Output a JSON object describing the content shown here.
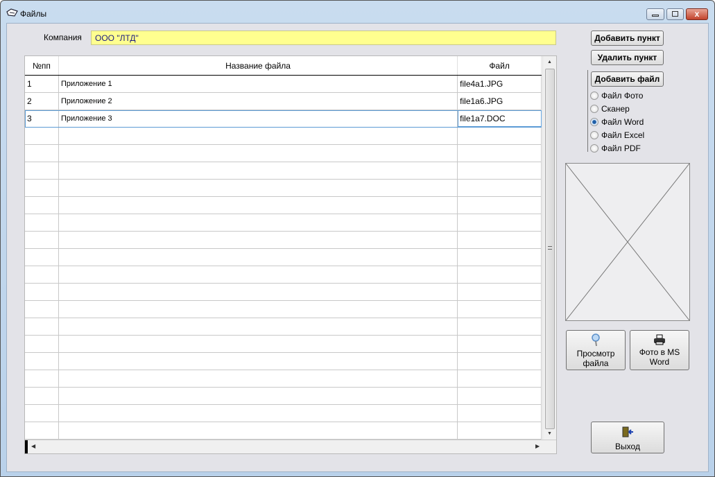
{
  "window": {
    "title": "Файлы",
    "close_glyph": "x"
  },
  "form": {
    "company_label": "Компания",
    "company_value": "ООО \"ЛТД\""
  },
  "table": {
    "headers": [
      "№пп",
      "Название файла",
      "Файл"
    ],
    "rows": [
      {
        "num": "1",
        "name": "Приложение 1",
        "file": "file4a1.JPG"
      },
      {
        "num": "2",
        "name": "Приложение 2",
        "file": "file1a6.JPG"
      },
      {
        "num": "3",
        "name": "Приложение 3",
        "file": "file1a7.DOC"
      }
    ],
    "selected_row": 3
  },
  "buttons": {
    "add_item": "Добавить пункт",
    "delete_item": "Удалить пункт",
    "add_file": "Добавить файл",
    "view_file": "Просмотр файла",
    "photo_word": "Фото в MS Word",
    "exit": "Выход"
  },
  "file_types": {
    "options": [
      "Файл Фото",
      "Сканер",
      "Файл Word",
      "Файл Excel",
      "Файл PDF"
    ],
    "selected": "Файл Word"
  }
}
